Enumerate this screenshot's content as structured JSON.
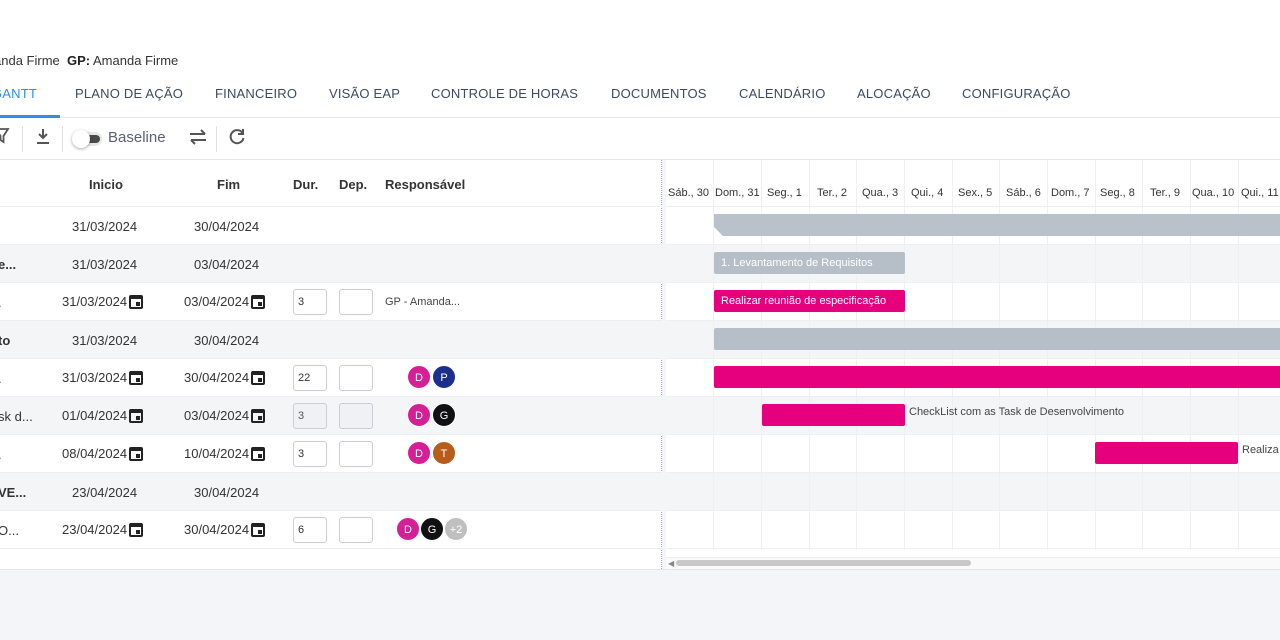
{
  "header": {
    "owner_suffix": "anda Firme",
    "gp_label": "GP:",
    "gp_value": "Amanda Firme"
  },
  "tabs": [
    {
      "label": "GANTT"
    },
    {
      "label": "PLANO DE AÇÃO"
    },
    {
      "label": "FINANCEIRO"
    },
    {
      "label": "VISÃO EAP"
    },
    {
      "label": "CONTROLE DE HORAS"
    },
    {
      "label": "DOCUMENTOS"
    },
    {
      "label": "CALENDÁRIO"
    },
    {
      "label": "ALOCAÇÃO"
    },
    {
      "label": "CONFIGURAÇÃO"
    }
  ],
  "toolbar": {
    "baseline_label": "Baseline",
    "baseline_enabled": false,
    "icons": [
      "filter-icon",
      "download-icon",
      "swap-icon",
      "refresh-icon"
    ]
  },
  "grid": {
    "columns": {
      "inicio": "Inicio",
      "fim": "Fim",
      "dur": "Dur.",
      "dep": "Dep.",
      "resp": "Responsável"
    },
    "rows": [
      {
        "name": "",
        "inicio": "31/03/2024",
        "fim": "30/04/2024"
      },
      {
        "name": "e...",
        "inicio": "31/03/2024",
        "fim": "03/04/2024"
      },
      {
        "name": ".",
        "inicio": "31/03/2024",
        "fim": "03/04/2024",
        "dur": "3",
        "dep": "",
        "resp": "GP - Amanda..."
      },
      {
        "name": "to",
        "inicio": "31/03/2024",
        "fim": "30/04/2024"
      },
      {
        "name": ".",
        "inicio": "31/03/2024",
        "fim": "30/04/2024",
        "dur": "22",
        "dep": "",
        "avatars": [
          "D",
          "P"
        ]
      },
      {
        "name": "sk d...",
        "inicio": "01/04/2024",
        "fim": "03/04/2024",
        "dur": "3",
        "dep": "",
        "avatars": [
          "D",
          "G"
        ]
      },
      {
        "name": ".",
        "inicio": "08/04/2024",
        "fim": "10/04/2024",
        "dur": "3",
        "dep": "",
        "avatars": [
          "D",
          "T"
        ]
      },
      {
        "name": "VE...",
        "inicio": "23/04/2024",
        "fim": "30/04/2024"
      },
      {
        "name": "O...",
        "inicio": "23/04/2024",
        "fim": "30/04/2024",
        "dur": "6",
        "dep": "",
        "avatars": [
          "D",
          "G"
        ],
        "more": "+2"
      }
    ]
  },
  "gantt": {
    "days": [
      "Sáb., 30",
      "Dom., 31",
      "Seg., 1",
      "Ter., 2",
      "Qua., 3",
      "Qui., 4",
      "Sex., 5",
      "Sáb., 6",
      "Dom., 7",
      "Seg., 8",
      "Ter., 9",
      "Qua., 10",
      "Qui., 11"
    ],
    "bars": {
      "req": "1. Levantamento de Requisitos",
      "meeting": "Realizar reunião de especificação",
      "checklist_outside": "CheckList com as Task de Desenvolvimento",
      "realiza_outside": "Realiza"
    }
  },
  "colors": {
    "accent": "#2e8ee8",
    "task": "#e6007e",
    "summary": "#b6bec8",
    "avatar_d": "#d61f96",
    "avatar_p": "#1c2f8c",
    "avatar_g": "#111111",
    "avatar_t": "#b85c1c",
    "avatar_more": "#bfbfbf"
  }
}
